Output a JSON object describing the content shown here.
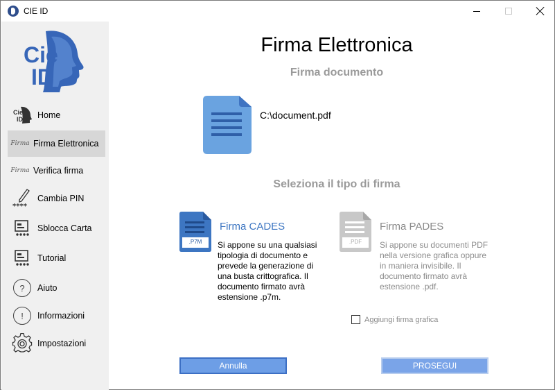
{
  "window": {
    "title": "CIE ID"
  },
  "sidebar": {
    "logo_line1": "Cie",
    "logo_line2": "ID",
    "items": [
      {
        "label": "Home",
        "icon": "cie-id-icon"
      },
      {
        "label": "Firma Elettronica",
        "icon": "signature-icon",
        "selected": true
      },
      {
        "label": "Verifica firma",
        "icon": "signature-icon"
      },
      {
        "label": "Cambia PIN",
        "icon": "pen-pin-icon"
      },
      {
        "label": "Sblocca Carta",
        "icon": "card-reader-icon"
      },
      {
        "label": "Tutorial",
        "icon": "card-reader-icon"
      },
      {
        "label": "Aiuto",
        "icon": "question-circle-icon",
        "glyph": "?"
      },
      {
        "label": "Informazioni",
        "icon": "info-circle-icon",
        "glyph": "!"
      },
      {
        "label": "Impostazioni",
        "icon": "gear-icon"
      }
    ],
    "signature_glyph": "Firma"
  },
  "main": {
    "title": "Firma Elettronica",
    "subtitle": "Firma documento",
    "file_path": "C:\\document.pdf",
    "section_title": "Seleziona il tipo di firma",
    "cades": {
      "title": "Firma CADES",
      "icon_label": ".P7M",
      "description": "Si appone su una qualsiasi tipologia di documento e prevede la generazione di una busta crittografica. Il documento firmato avrà estensione .p7m."
    },
    "pades": {
      "title": "Firma PADES",
      "icon_label": ".PDF",
      "description": "Si appone su documenti PDF nella versione grafica oppure in maniera invisibile. Il documento firmato avrà estensione .pdf."
    },
    "checkbox_label": "Aggiungi firma grafica",
    "cancel_label": "Annulla",
    "next_label": "PROSEGUI"
  },
  "colors": {
    "accent": "#3d76c2",
    "button": "#6d9ee6",
    "sidebar_bg": "#f0f0f0",
    "selected_bg": "#d7d7d7",
    "muted_text": "#9a9a9a"
  }
}
